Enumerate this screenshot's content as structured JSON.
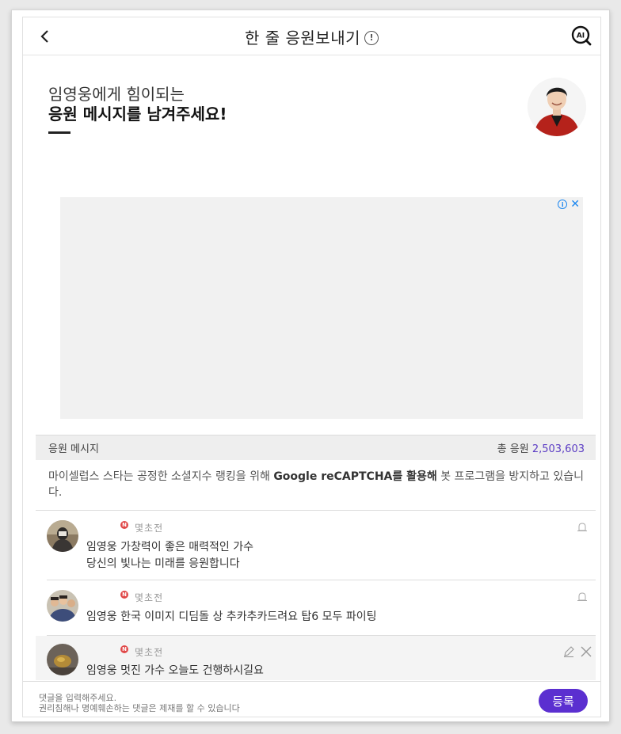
{
  "header": {
    "title": "한 줄 응원보내기",
    "info_icon": "!",
    "ai_label": "AI"
  },
  "hero": {
    "line1": "임영웅에게 힘이되는",
    "line2": "응원 메시지를 남겨주세요!"
  },
  "ad": {
    "info_icon": "i",
    "close_icon": "✕"
  },
  "messages": {
    "section_label": "응원 메시지",
    "total_label": "총 응원",
    "total_count": "2,503,603"
  },
  "notice": {
    "before": "마이셀럽스 스타는 공정한 소셜지수 랭킹을 위해 ",
    "bold": "Google reCAPTCHA를 활용해",
    "after": " 봇 프로그램을 방지하고 있습니다."
  },
  "comments": [
    {
      "badge": "N",
      "time": "몇초전",
      "line1": "임영웅 가창력이 좋은 매력적인 가수",
      "line2": "당신의 빛나는 미래를 응원합니다"
    },
    {
      "badge": "N",
      "time": "몇초전",
      "line1": "임영웅 한국 이미지 디딤돌 상 추카추카드려요 탑6 모두 파이팅"
    },
    {
      "badge": "N",
      "time": "몇초전",
      "line1": "임영웅 멋진 가수 오늘도 건행하시길요"
    }
  ],
  "input": {
    "placeholder": "댓글을 입력해주세요.",
    "warning": "권리침해나 명예훼손하는 댓글은 제재를 할 수 있습니다",
    "submit_label": "등록"
  },
  "colors": {
    "accent": "#5b2fd0",
    "count": "#5b3cc4",
    "new_badge": "#e04848",
    "ad_icon": "#1c87f0"
  }
}
